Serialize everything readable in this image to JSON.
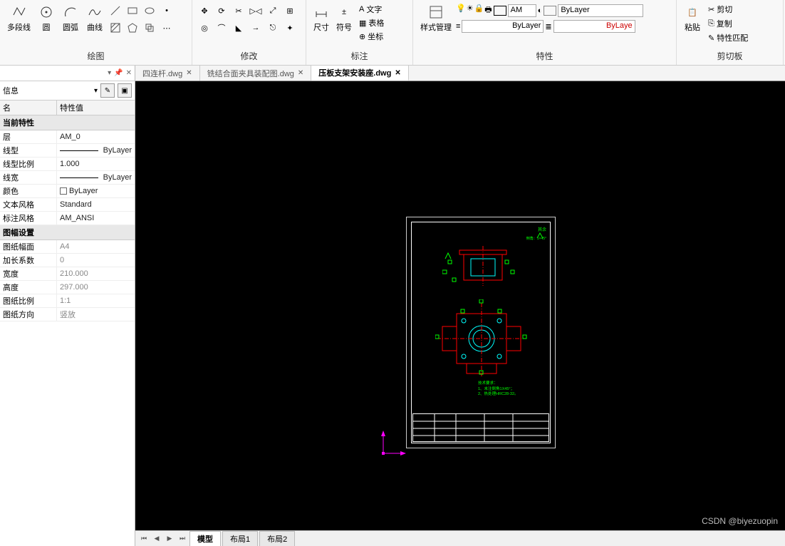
{
  "ribbon": {
    "draw": {
      "label": "绘图",
      "polyline": "多段线",
      "circle": "圆",
      "arc": "圆弧",
      "spline": "曲线"
    },
    "modify": {
      "label": "修改"
    },
    "annotate": {
      "label": "标注",
      "text": "文字",
      "dim": "尺寸",
      "symbol": "符号",
      "table": "表格",
      "coord": "坐标"
    },
    "style": {
      "label": "特性",
      "styleMgr": "样式管理",
      "layerDropLabel": "AM",
      "colorDrop": "ByLayer",
      "linetypeDrop": "ByLayer",
      "lineweightDrop": "ByLaye"
    },
    "clipboard": {
      "label": "剪切板",
      "paste": "粘贴",
      "cut": "剪切",
      "copy": "复制",
      "match": "特性匹配"
    }
  },
  "tabs": {
    "file1": "四连杆.dwg",
    "file2": "铣结合面夹具装配图.dwg",
    "file3": "压板支架安装座.dwg"
  },
  "propPanel": {
    "info": "信息",
    "headerName": "名",
    "headerVal": "特性值",
    "section1": "当前特性",
    "rows1": [
      {
        "k": "层",
        "v": "AM_0"
      },
      {
        "k": "线型",
        "v": "ByLayer",
        "line": true
      },
      {
        "k": "线型比例",
        "v": "1.000"
      },
      {
        "k": "线宽",
        "v": "ByLayer",
        "line": true
      },
      {
        "k": "颜色",
        "v": "ByLayer",
        "color": true
      },
      {
        "k": "文本风格",
        "v": "Standard"
      },
      {
        "k": "标注风格",
        "v": "AM_ANSI"
      }
    ],
    "section2": "图幅设置",
    "rows2": [
      {
        "k": "图纸幅面",
        "v": "A4"
      },
      {
        "k": "加长系数",
        "v": "0"
      },
      {
        "k": "宽度",
        "v": "210.000"
      },
      {
        "k": "高度",
        "v": "297.000"
      },
      {
        "k": "图纸比例",
        "v": "1:1"
      },
      {
        "k": "图纸方向",
        "v": "竖放"
      }
    ]
  },
  "drawing": {
    "note_title": "其余",
    "note_chamfer": "倒角：1×45°",
    "tech_req_title": "技术要求：",
    "tech_req_1": "1、未注倒角1X45°；",
    "tech_req_2": "2、热处理HRC28-32。"
  },
  "layoutTabs": {
    "model": "模型",
    "layout1": "布局1",
    "layout2": "布局2"
  },
  "watermark": "CSDN @biyezuopin"
}
